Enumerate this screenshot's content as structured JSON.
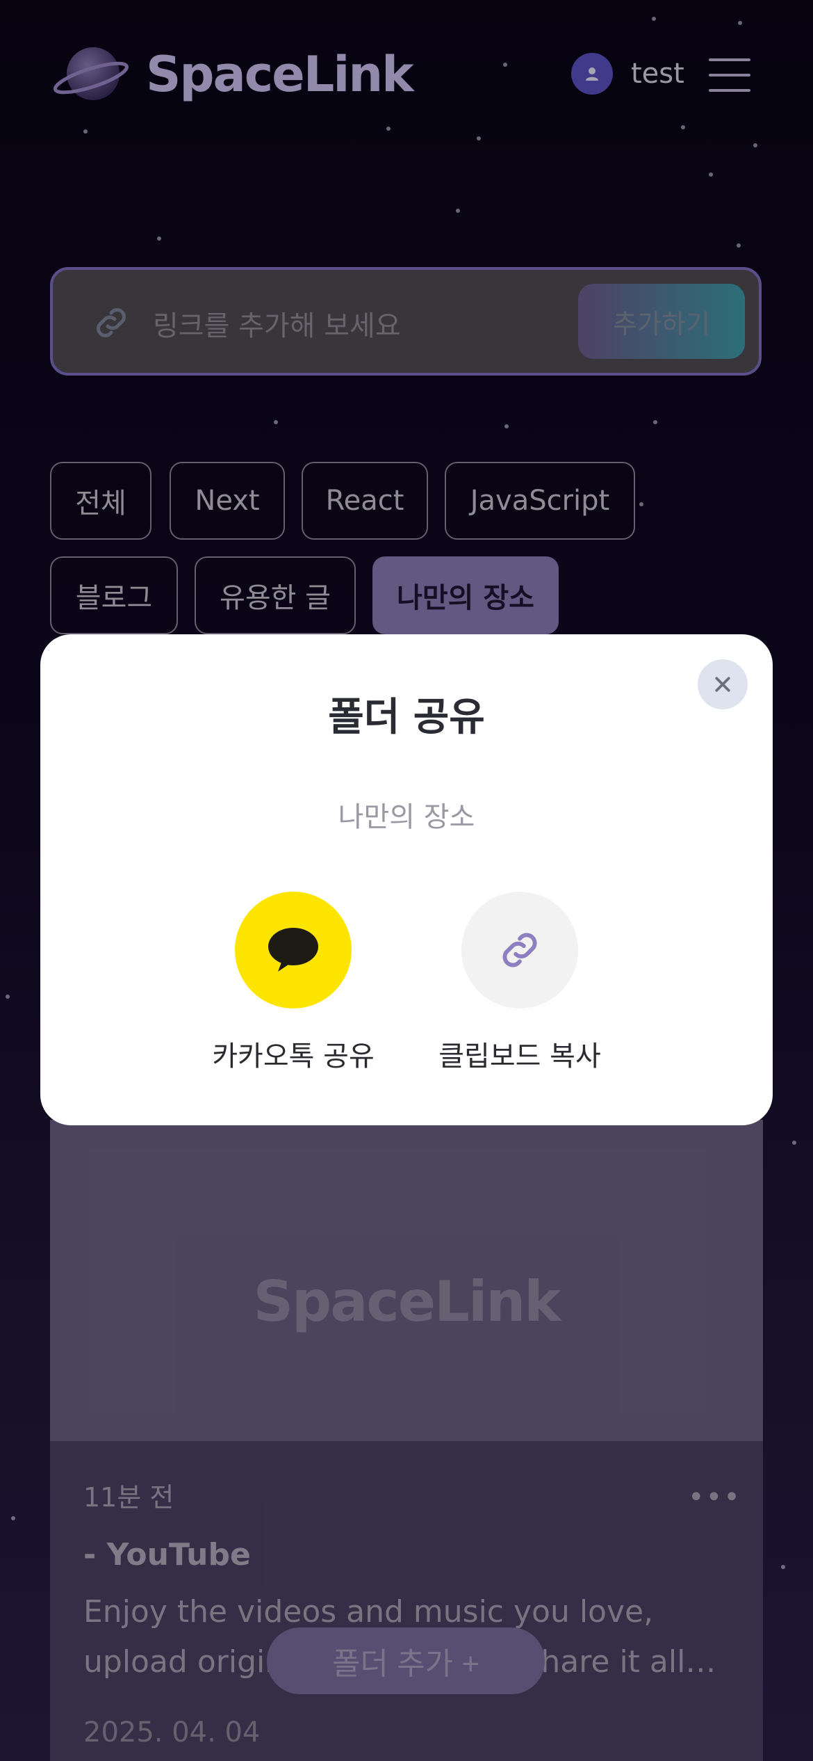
{
  "header": {
    "brand": "SpaceLink",
    "username": "test"
  },
  "search": {
    "placeholder": "링크를 추가해 보세요",
    "add_label": "추가하기"
  },
  "tags": [
    {
      "label": "전체"
    },
    {
      "label": "Next"
    },
    {
      "label": "React"
    },
    {
      "label": "JavaScript"
    },
    {
      "label": "블로그"
    },
    {
      "label": "유용한 글"
    },
    {
      "label": "나만의 장소",
      "active": true
    }
  ],
  "card": {
    "thumb_logo": "SpaceLink",
    "time": "11분 전",
    "title": "- YouTube",
    "description": "Enjoy the videos and music you love, upload original content, and share it all with friends, family, and the world on YouTube.",
    "date": "2025. 04. 04"
  },
  "folder_add_label": "폴더 추가 +",
  "modal": {
    "title": "폴더 공유",
    "folder_name": "나만의 장소",
    "kakao_label": "카카오톡 공유",
    "clipboard_label": "클립보드 복사"
  },
  "colors": {
    "kakao": "#FEE500",
    "accent": "#8a7bb4",
    "clipboard_bg": "#f2f2f2"
  }
}
